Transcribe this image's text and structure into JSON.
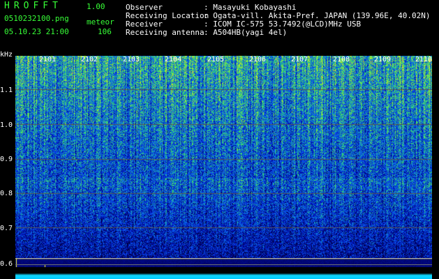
{
  "header": {
    "app_name": "HROFFT",
    "version": "1.00",
    "filename": "0510232100.png",
    "datetime": "05.10.23 21:00",
    "meteor_label": "meteor",
    "meteor_count": "106"
  },
  "info": {
    "observer_label": "Observer",
    "observer_value": ": Masayuki Kobayashi",
    "location_label": "Receiving Location",
    "location_value": ": Ogata-vill. Akita-Pref. JAPAN (139.96E, 40.02N)",
    "receiver_label": "Receiver",
    "receiver_value": ": ICOM IC-575 53.7492(@LCD)MHz USB",
    "antenna_label": "Receiving antenna",
    "antenna_value": ": A504HB(yagi 4el)"
  },
  "axis": {
    "unit": "kHz",
    "yticks": [
      "1.1",
      "1.0",
      "0.9",
      "0.8",
      "0.7",
      "0.6"
    ],
    "xticks": [
      "2101",
      "2102",
      "2103",
      "2104",
      "2105",
      "2106",
      "2107",
      "2108",
      "2109",
      "2110"
    ]
  },
  "colors": {
    "text_green": "#37ff37",
    "bg": "#000000",
    "spectrum_low": "#001070",
    "spectrum_mid": "#1040ff",
    "spectrum_high": "#30d0a0",
    "baseline": "#11d8ff"
  }
}
